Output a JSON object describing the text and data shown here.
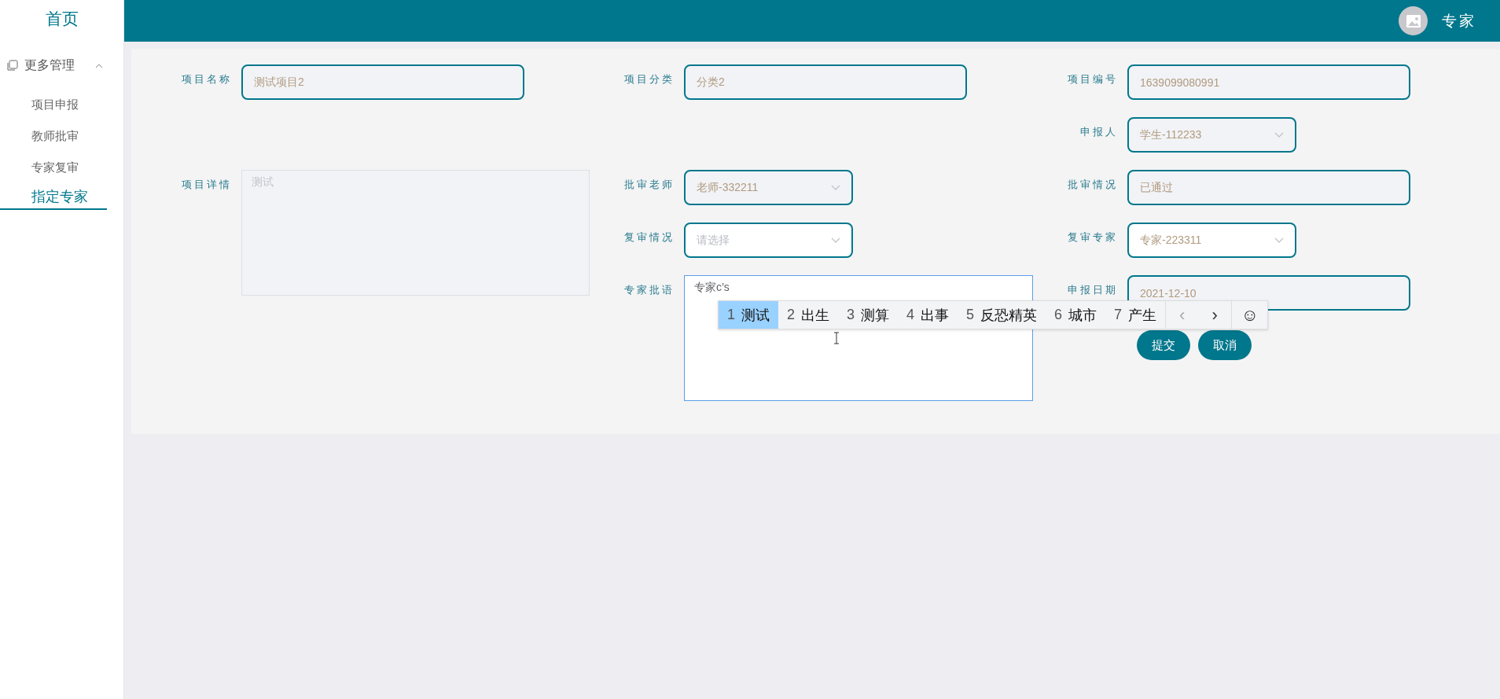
{
  "sidebar": {
    "home": "首页",
    "group": {
      "label": "更多管理",
      "expanded": true,
      "items": [
        {
          "label": "项目申报",
          "selected": false
        },
        {
          "label": "教师批审",
          "selected": false
        },
        {
          "label": "专家复审",
          "selected": false
        },
        {
          "label": "指定专家",
          "selected": true
        }
      ]
    }
  },
  "header": {
    "user": "专家"
  },
  "form": {
    "columns": [
      [
        {
          "kind": "input",
          "label": "项目名称",
          "value": "测试项目2",
          "disabled": true
        },
        {
          "kind": "textarea",
          "label": "项目详情",
          "value": "测试",
          "disabled": true,
          "focused": false
        }
      ],
      [
        {
          "kind": "input",
          "label": "项目分类",
          "value": "分类2",
          "disabled": true
        },
        {
          "kind": "select",
          "label": "批审老师",
          "value": "老师-332211",
          "disabled": true
        },
        {
          "kind": "select",
          "label": "复审情况",
          "placeholder": "请选择",
          "disabled": false
        },
        {
          "kind": "textarea",
          "label": "专家批语",
          "value": "专家c’s",
          "disabled": false,
          "focused": true
        }
      ],
      [
        {
          "kind": "input",
          "label": "项目编号",
          "value": "1639099080991",
          "disabled": true
        },
        {
          "kind": "select",
          "label": "申报人",
          "value": "学生-112233",
          "disabled": true
        },
        {
          "kind": "input",
          "label": "批审情况",
          "value": "已通过",
          "disabled": true
        },
        {
          "kind": "select",
          "label": "复审专家",
          "value": "专家-223311",
          "disabled": false
        },
        {
          "kind": "input",
          "label": "申报日期",
          "value": "2021-12-10",
          "disabled": true
        }
      ]
    ],
    "buttons": [
      "提交",
      "取消"
    ]
  },
  "ime": {
    "candidates": [
      {
        "index": "1",
        "text": "测试",
        "selected": true
      },
      {
        "index": "2",
        "text": "出生",
        "selected": false
      },
      {
        "index": "3",
        "text": "测算",
        "selected": false
      },
      {
        "index": "4",
        "text": "出事",
        "selected": false
      },
      {
        "index": "5",
        "text": "反恐精英",
        "selected": false
      },
      {
        "index": "6",
        "text": "城市",
        "selected": false
      },
      {
        "index": "7",
        "text": "产生",
        "selected": false
      }
    ],
    "prev": "‹",
    "next": "›",
    "emoji": "☺"
  }
}
